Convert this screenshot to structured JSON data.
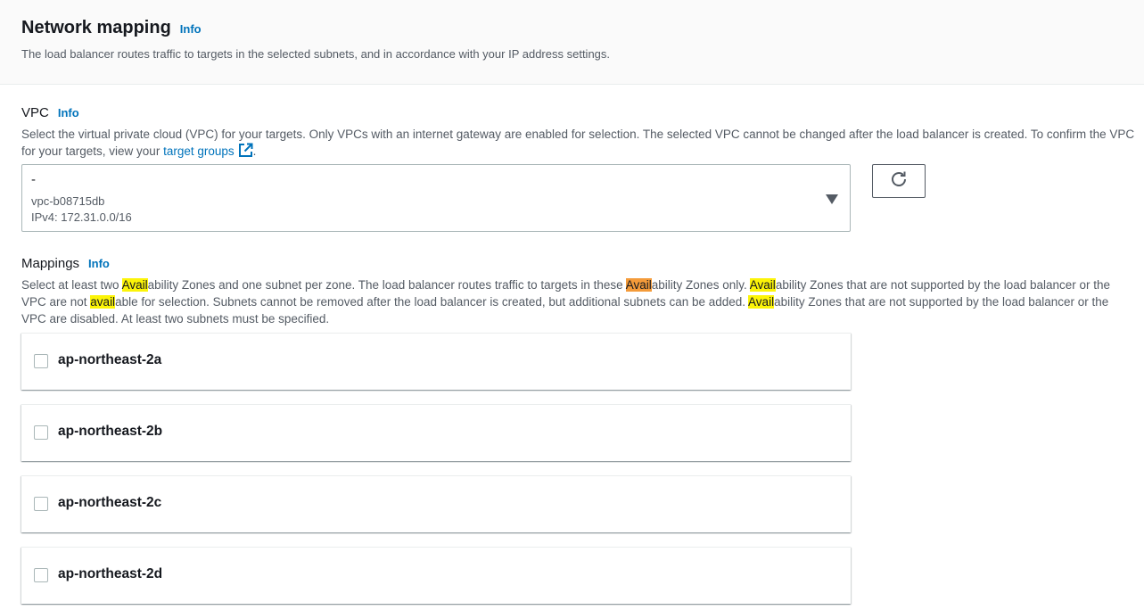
{
  "header": {
    "title": "Network mapping",
    "info": "Info",
    "description": "The load balancer routes traffic to targets in the selected subnets, and in accordance with your IP address settings."
  },
  "vpc": {
    "label": "VPC",
    "info": "Info",
    "description_1": "Select the virtual private cloud (VPC) for your targets. Only VPCs with an internet gateway are enabled for selection. The selected VPC cannot be changed after the load balancer is created. To confirm the VPC for your targets, view your",
    "link": "target groups",
    "description_end": ".",
    "selected_name": "-",
    "selected_id": "vpc-b08715db",
    "selected_cidr": "IPv4: 172.31.0.0/16",
    "refresh_icon": "refresh-icon"
  },
  "mappings": {
    "label": "Mappings",
    "info": "Info",
    "desc": {
      "p1": "Select at least two ",
      "h1": "Avail",
      "p2": "ability Zones and one subnet per zone. The load balancer routes traffic to targets in these ",
      "h2": "Avail",
      "p3": "ability Zones only. ",
      "h3": "Avail",
      "p4": "ability Zones that are not supported by the load balancer or the VPC are not ",
      "h4": "avail",
      "p5": "able for selection. Subnets cannot be removed after the load balancer is created, but additional subnets can be added. ",
      "h5": "Avail",
      "p6": "ability Zones that are not supported by the load balancer or the VPC are disabled. At least two subnets must be specified."
    },
    "zones": [
      {
        "name": "ap-northeast-2a",
        "checked": false
      },
      {
        "name": "ap-northeast-2b",
        "checked": false
      },
      {
        "name": "ap-northeast-2c",
        "checked": false
      },
      {
        "name": "ap-northeast-2d",
        "checked": false
      }
    ]
  },
  "colors": {
    "link": "#0073bb",
    "search_highlight": "#fcf408",
    "search_current": "#f49b3a"
  }
}
